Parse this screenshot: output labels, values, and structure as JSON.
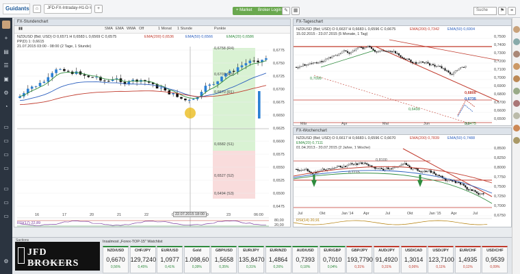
{
  "app": {
    "logo": "Guidants",
    "tabs": [
      "JFD-FX-Intraday-H1-D-W"
    ],
    "buttons": {
      "market": "+ Market",
      "broker_login": "Broker Login"
    },
    "search_placeholder": "Suche"
  },
  "panel_h1": {
    "title": "FX-Stundenchart",
    "toolbar": [
      "SMA",
      "EMA",
      "WMA",
      "Off",
      "1 Monat",
      "1 Stunde",
      "Punkte"
    ],
    "info_line1": "NZDUSD (Bid; USD)  O 0,6571  H 0,6583  L 0,6569  C 0,6575",
    "ema200": "EMA(200)  0,6536",
    "ema50": "EMA(50)  0,6566",
    "ema20": "EMA(20)  0,6586",
    "ppd": "PP(D)  1: 0,6615",
    "date_info": "21.07.2015 03:00 - 08:00 (2 Tage, 1 Stunde)",
    "rsi": "RSI(17)  22,89",
    "cursor_time": "22.07.2015 18:00",
    "levels": [
      "0,6758 (R4)",
      "0,6703 (R3)",
      "0,6670 (R1)",
      "0,6582 (S1)",
      "0,6527 (S2)",
      "0,6494 (S3)"
    ],
    "price_axis": [
      "0,6775",
      "0,6750",
      "0,6725",
      "0,6700",
      "0,6675",
      "0,6650",
      "0,6625",
      "0,6600",
      "0,6575",
      "0,6550",
      "0,6525",
      "0,6500",
      "0,6475"
    ],
    "time_axis": [
      "16",
      "17",
      "20",
      "21",
      "22",
      "04:00",
      "12:00",
      "23",
      "06:00"
    ],
    "rsi_axis": [
      "80,00",
      "20,00"
    ]
  },
  "panel_daily": {
    "title": "FX-Tageschart",
    "info_line1": "NZDUSD (Bid; USD)  O 0,6637  H 0,6683  L 0,6596  C 0,6675",
    "date_info": "15.02.2015 - 23.07.2015 (5 Monate, 1 Tag)",
    "ema200": "EMA(200)  0,7342",
    "ema50": "EMA(50)  0,6904",
    "annotations": [
      "0,6800",
      "0,6735",
      "0,6499",
      "0,7099",
      "0,6475"
    ],
    "price_axis": [
      "0,7500",
      "0,7400",
      "0,7300",
      "0,7200",
      "0,7100",
      "0,7000",
      "0,6900",
      "0,6800",
      "0,6700",
      "0,6600",
      "0,6500"
    ],
    "time_axis": [
      "Mär",
      "Apr",
      "Mai",
      "Jun",
      "Jul"
    ]
  },
  "panel_weekly": {
    "title": "FX-Wochenchart",
    "info_line1": "NZDUSD (Bid; USD)  O 0,6617  H 0,6683  L 0,6596  C 0,6670",
    "date_info": "01.04.2013 - 20.07.2015 (2 Jahre, 1 Woche)",
    "ema200": "EMA(200)  0,7839",
    "ema50": "EMA(50)  0,7488",
    "ema20": "EMA(20)  0,7111",
    "annotations": [
      "0,8100",
      "0,7715"
    ],
    "rsi": "RSI(14)  20,91",
    "price_axis": [
      "0,8500",
      "0,8250",
      "0,8000",
      "0,7750",
      "0,7500",
      "0,7250",
      "0,7000",
      "0,6750"
    ],
    "time_axis": [
      "Jul",
      "Okt",
      "Jan '14",
      "Apr",
      "Jul",
      "Okt",
      "Jan '15",
      "Apr",
      "Jul"
    ]
  },
  "watchlist": {
    "title": "Insalmost „Forex-TOP-15\" Watchlist",
    "broker": "JFD BROKERS",
    "broker_tagline": "DIRECT MARKET ACCESS",
    "section": "Sactions",
    "tiles": [
      {
        "name": "NZD/USD",
        "price": "0,6670",
        "change": "0,56%",
        "dir": "pos"
      },
      {
        "name": "CHF/JPY",
        "price": "129,7240",
        "change": "0,45%",
        "dir": "pos"
      },
      {
        "name": "EUR/USD",
        "price": "1,0977",
        "change": "0,41%",
        "dir": "pos"
      },
      {
        "name": "Gold",
        "price": "1.098,60",
        "change": "0,39%",
        "dir": "pos"
      },
      {
        "name": "GBP/USD",
        "price": "1,5658",
        "change": "0,35%",
        "dir": "pos"
      },
      {
        "name": "EUR/JPY",
        "price": "135,8470",
        "change": "0,31%",
        "dir": "pos"
      },
      {
        "name": "EUR/NZD",
        "price": "1,4864",
        "change": "0,26%",
        "dir": "pos"
      },
      {
        "name": "AUD/USD",
        "price": "0,7393",
        "change": "0,18%",
        "dir": "pos"
      },
      {
        "name": "EUR/GBP",
        "price": "0,7010",
        "change": "0,04%",
        "dir": "pos"
      },
      {
        "name": "GBP/JPY",
        "price": "193,7790",
        "change": "0,31%",
        "dir": "neg"
      },
      {
        "name": "AUD/JPY",
        "price": "91,4920",
        "change": "0,31%",
        "dir": "neg"
      },
      {
        "name": "USD/CAD",
        "price": "1,3014",
        "change": "0,06%",
        "dir": "neg"
      },
      {
        "name": "USD/JPY",
        "price": "123,7100",
        "change": "0,11%",
        "dir": "neg"
      },
      {
        "name": "EUR/CHF",
        "price": "1,4935",
        "change": "0,11%",
        "dir": "neg"
      },
      {
        "name": "USD/CHF",
        "price": "0,9539",
        "change": "0,09%",
        "dir": "neg"
      }
    ]
  },
  "colors": {
    "candle_up": "#2a7fd4",
    "candle_down": "#111111",
    "ema200": "#c0392b",
    "ema50": "#2b5fbf",
    "ema20": "#2e8b3d",
    "target_zone": "#d9f2d3",
    "stop_zone": "#f9dcdc",
    "cursor": "#e8b400"
  }
}
